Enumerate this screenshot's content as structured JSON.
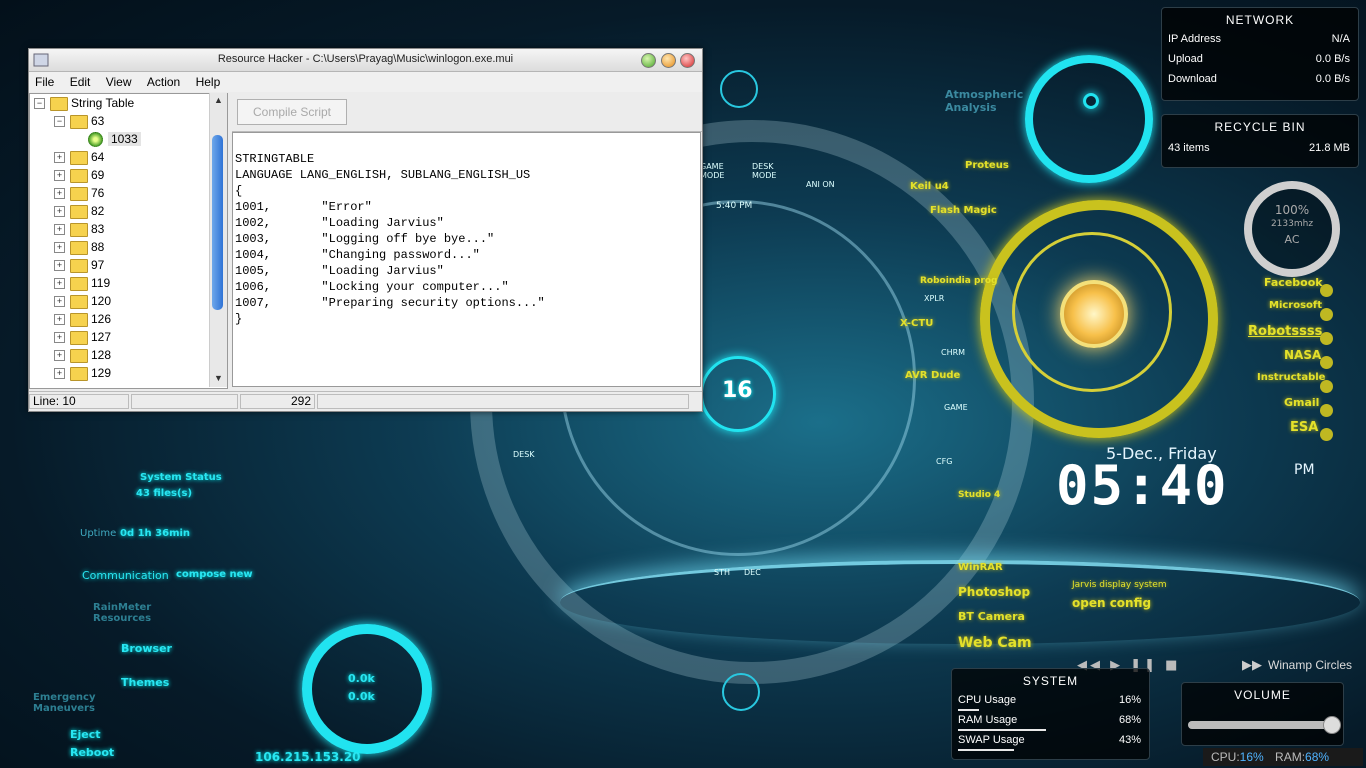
{
  "window": {
    "title": "Resource Hacker  -  C:\\Users\\Prayag\\Music\\winlogon.exe.mui",
    "menu": [
      "File",
      "Edit",
      "View",
      "Action",
      "Help"
    ],
    "compile_button": "Compile Script",
    "tree": {
      "root": "String Table",
      "open_node": "63",
      "selected_leaf": "1033",
      "nodes": [
        "64",
        "69",
        "76",
        "82",
        "83",
        "88",
        "97",
        "119",
        "120",
        "126",
        "127",
        "128",
        "129"
      ]
    },
    "code_lines": [
      "STRINGTABLE",
      "LANGUAGE LANG_ENGLISH, SUBLANG_ENGLISH_US",
      "{",
      "1001,       \"Error\"",
      "1002,       \"Loading Jarvius\"",
      "1003,       \"Logging off bye bye...\"",
      "1004,       \"Changing password...\"",
      "1005,       \"Loading Jarvius\"",
      "1006,       \"Locking your computer...\"",
      "1007,       \"Preparing security options...\"",
      "}"
    ],
    "status": {
      "line": "Line: 10",
      "count": "292"
    }
  },
  "network": {
    "title": "NETWORK",
    "rows": [
      {
        "label": "IP Address",
        "value": "N/A"
      },
      {
        "label": "Upload",
        "value": "0.0 B/s"
      },
      {
        "label": "Download",
        "value": "0.0 B/s"
      }
    ]
  },
  "recycle": {
    "title": "RECYCLE BIN",
    "items": "43 items",
    "size": "21.8 MB"
  },
  "power": {
    "percent": "100%",
    "freq": "2133mhz",
    "source": "AC"
  },
  "clock": {
    "date": "5-Dec., Friday",
    "time": "05:40",
    "ampm": "PM"
  },
  "jarvis_links": [
    "Facebook",
    "Microsoft",
    "Robotssss",
    "NASA",
    "Instructable",
    "Gmail",
    "ESA"
  ],
  "jarvis_left_links": [
    "Proteus",
    "Keil u4",
    "Flash Magic",
    "Roboindia prog",
    "X-CTU",
    "AVR Dude",
    "Studio 4"
  ],
  "jarvis_bottom_links": [
    "WinRAR",
    "Photoshop",
    "BT Camera",
    "Web Cam"
  ],
  "jarvis_caption": "Jarvis display system",
  "open_config": "open config",
  "atmospheric": "Atmospheric Analysis",
  "hud_center_number": "16",
  "hud_labels": [
    "GAME MODE",
    "DESK MODE",
    "ANI ON",
    "XPLR",
    "CHRM",
    "GAME",
    "CFG",
    "DESK",
    "STH",
    "DEC"
  ],
  "hud_time": "5:40  PM",
  "left_widgets": {
    "system_status": "System Status",
    "files": "43 files(s)",
    "uptime_label": "Uptime",
    "uptime": "0d 1h 36min",
    "communication": "Communication",
    "compose": "compose new",
    "rainmeter": "RainMeter Resources",
    "browser": "Browser",
    "themes": "Themes",
    "emergency": "Emergency Maneuvers",
    "eject": "Eject",
    "reboot": "Reboot",
    "net_up": "0.0k",
    "net_down": "0.0k",
    "ip": "106.215.153.20"
  },
  "system": {
    "title": "SYSTEM",
    "rows": [
      {
        "label": "CPU Usage",
        "value": "16%",
        "fraction": 0.16
      },
      {
        "label": "RAM Usage",
        "value": "68%",
        "fraction": 0.68
      },
      {
        "label": "SWAP Usage",
        "value": "43%",
        "fraction": 0.43
      }
    ]
  },
  "winamp": "Winamp Circles",
  "volume": {
    "title": "VOLUME",
    "level": 1.0
  },
  "taskbar_stats": {
    "cpu_label": "CPU:",
    "cpu": "16%",
    "ram_label": "RAM:",
    "ram": "68%"
  },
  "colors": {
    "cyan": "#29e6f2",
    "yellow": "#e4e12a"
  }
}
